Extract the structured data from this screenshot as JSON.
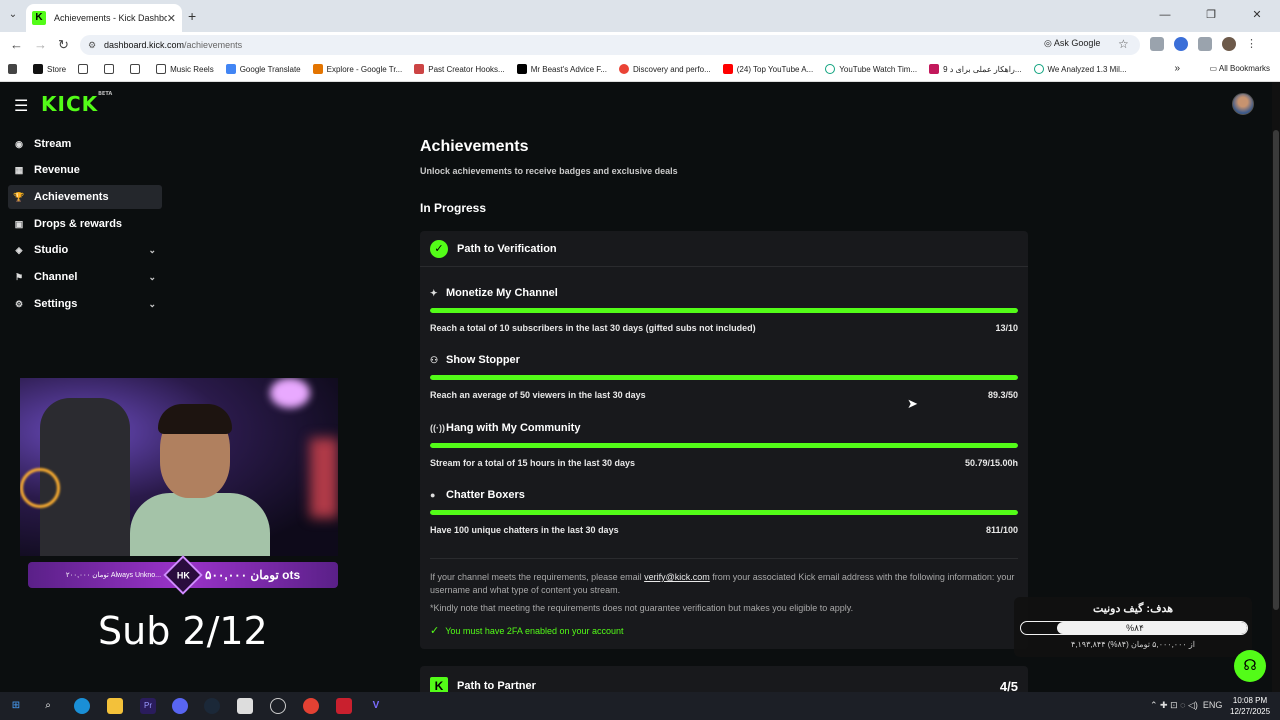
{
  "browser": {
    "tab_title": "Achievements - Kick Dashboard",
    "url_host": "dashboard.kick.com",
    "url_path": "/achievements",
    "ask_google": "Ask Google",
    "bookmarks": [
      {
        "label": "Store",
        "icon": "amazon-icon"
      },
      {
        "label": "",
        "icon": "folder-icon"
      },
      {
        "label": "",
        "icon": "folder-icon"
      },
      {
        "label": "",
        "icon": "folder-icon"
      },
      {
        "label": "Music Reels",
        "icon": "folder-icon"
      },
      {
        "label": "Google Translate",
        "icon": "translate-icon"
      },
      {
        "label": "Explore - Google Tr...",
        "icon": "trends-icon"
      },
      {
        "label": "Past Creator Hooks...",
        "icon": "page-icon"
      },
      {
        "label": "Mr Beast's Advice F...",
        "icon": "tiktok-icon"
      },
      {
        "label": "Discovery and perfo...",
        "icon": "google-icon"
      },
      {
        "label": "(24) Top YouTube A...",
        "icon": "youtube-icon"
      },
      {
        "label": "YouTube Watch Tim...",
        "icon": "chatgpt-icon"
      },
      {
        "label": "9 راهکار عملی برای د...",
        "icon": "page-icon"
      },
      {
        "label": "We Analyzed 1.3 Mil...",
        "icon": "chatgpt-icon"
      }
    ],
    "all_bookmarks": "All Bookmarks"
  },
  "sidebar": {
    "logo": "KICK",
    "logo_badge": "BETA",
    "items": [
      {
        "label": "Stream",
        "icon": "video-icon",
        "active": false,
        "expandable": false
      },
      {
        "label": "Revenue",
        "icon": "chart-icon",
        "active": false,
        "expandable": false
      },
      {
        "label": "Achievements",
        "icon": "trophy-icon",
        "active": true,
        "expandable": false
      },
      {
        "label": "Drops & rewards",
        "icon": "gift-icon",
        "active": false,
        "expandable": false
      },
      {
        "label": "Studio",
        "icon": "studio-icon",
        "active": false,
        "expandable": true
      },
      {
        "label": "Channel",
        "icon": "channel-icon",
        "active": false,
        "expandable": true
      },
      {
        "label": "Settings",
        "icon": "gear-icon",
        "active": false,
        "expandable": true
      }
    ]
  },
  "overlay": {
    "donate_left": "۲۰۰,۰۰۰ تومان Always Unkno...",
    "donate_badge": "HK",
    "donate_right": "۵۰۰,۰۰۰ تومان ots",
    "sub_text": "Sub 2/12",
    "goal_title": "هدف: گیف دونیت",
    "goal_percent": "%۸۴",
    "goal_progress": 0.84,
    "goal_sub": "۴,۱۹۳,۸۴۴ از ۵,۰۰۰,۰۰۰ تومان (۸۴%)"
  },
  "main": {
    "title": "Achievements",
    "subtitle": "Unlock achievements to receive badges and exclusive deals",
    "section": "In Progress",
    "card": {
      "title": "Path to Verification",
      "achievements": [
        {
          "name": "Monetize My Channel",
          "icon": "sparkle-icon",
          "desc": "Reach a total of 10 subscribers in the last 30 days (gifted subs not included)",
          "value": "13/10",
          "progress": 1.0
        },
        {
          "name": "Show Stopper",
          "icon": "users-icon",
          "desc": "Reach an average of 50 viewers in the last 30 days",
          "value": "89.3/50",
          "progress": 1.0
        },
        {
          "name": "Hang with My Community",
          "icon": "broadcast-icon",
          "desc": "Stream for a total of 15 hours in the last 30 days",
          "value": "50.79/15.00h",
          "progress": 1.0
        },
        {
          "name": "Chatter Boxers",
          "icon": "chat-icon",
          "desc": "Have 100 unique chatters in the last 30 days",
          "value": "811/100",
          "progress": 1.0
        }
      ],
      "info_before": "If your channel meets the requirements, please email ",
      "info_email": "verify@kick.com",
      "info_after": " from your associated Kick email address with the following information: your username and what type of content you stream.",
      "note": "*Kindly note that meeting the requirements does not guarantee verification but makes you eligible to apply.",
      "twofa": "You must have 2FA enabled on your account"
    },
    "card2": {
      "title": "Path to Partner",
      "count": "4/5"
    }
  },
  "taskbar": {
    "lang": "ENG",
    "time": "10:08 PM",
    "date": "12/27/2025"
  },
  "colors": {
    "accent": "#53fc18",
    "background": "#0b0e0f",
    "card": "#18191c"
  }
}
